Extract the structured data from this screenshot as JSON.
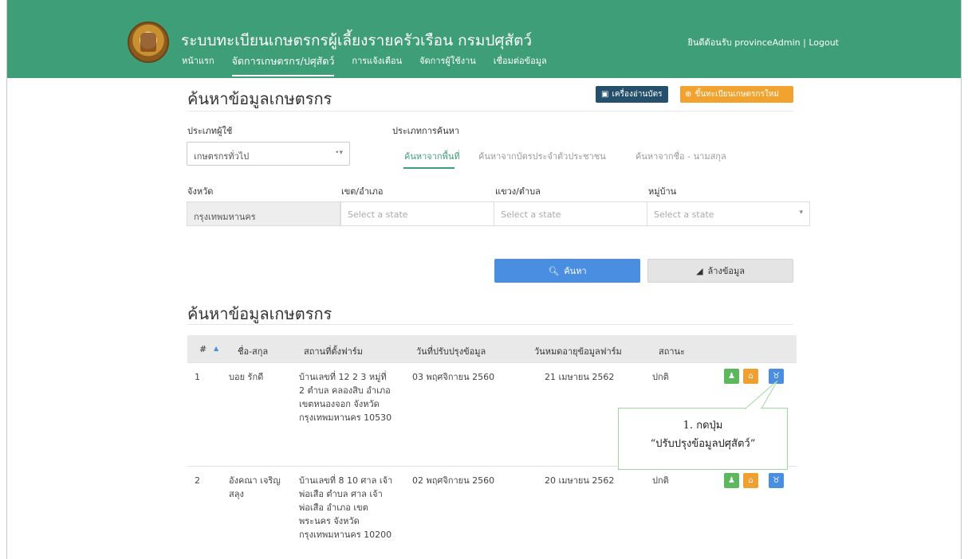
{
  "header": {
    "app_title": "ระบบทะเบียนเกษตรกรผู้เลี้ยงรายครัวเรือน กรมปศุสัตว์",
    "welcome": "ยินดีต้อนรับ provinceAdmin |",
    "logout": "Logout",
    "nav": [
      "หน้าแรก",
      "จัดการเกษตรกร/ปศุสัตว์",
      "การแจ้งเตือน",
      "จัดการผู้ใช้งาน",
      "เชื่อมต่อข้อมูล"
    ]
  },
  "search": {
    "title": "ค้นหาข้อมูลเกษตรกร",
    "reader_button": "เครื่องอ่านบัตร",
    "register_button": "ขึ้นทะเบียนเกษตรกรใหม่",
    "user_type_label": "ประเภทผู้ใช้",
    "user_type_value": "เกษตรกรทั่วไป",
    "search_type_label": "ประเภทการค้นหา",
    "tabs": [
      "ค้นหาจากพื้นที่",
      "ค้นหาจากบัตรประจำตัวประชาชน",
      "ค้นหาจากชื่อ - นามสกุล"
    ],
    "province_label": "จังหวัด",
    "district_label": "เขต/อำเภอ",
    "subdistrict_label": "แขวง/ตำบล",
    "village_label": "หมู่บ้าน",
    "province_value": "กรุงเทพมหานคร",
    "placeholder": "Select a state",
    "search_button": "ค้นหา",
    "clear_button": "ล้างข้อมูล"
  },
  "results": {
    "title": "ค้นหาข้อมูลเกษตรกร",
    "columns": [
      "#",
      "ชื่อ-สกุล",
      "สถานที่ตั้งฟาร์ม",
      "วันที่ปรับปรุงข้อมูล",
      "วันหมดอายุข้อมูลฟาร์ม",
      "สถานะ"
    ],
    "sort_indicator": "▲",
    "rows": [
      {
        "num": "1",
        "name": "บอย รักดี",
        "address": "บ้านเลขที่ 12 2 3 หมู่ที่ 2 ตำบล คลองสิบ อำเภอ เขตหนองจอก จังหวัด กรุงเทพมหานคร 10530",
        "updated": "03 พฤศจิกายน 2560",
        "expires": "21 เมษายน 2562",
        "status": "ปกติ"
      },
      {
        "num": "2",
        "name": "อังคณา เจริญสลุง",
        "address": "บ้านเลขที่ 8 10 ศาล เจ้าพ่อเสือ ตำบล ศาล เจ้าพ่อเสือ อำเภอ เขต พระนคร จังหวัด กรุงเทพมหานคร 10200",
        "updated": "02 พฤศจิกายน 2560",
        "expires": "20 เมษายน 2562",
        "status": "ปกติ"
      }
    ]
  },
  "callout": {
    "line1": "1. กดปุ่ม",
    "line2": "“ปรับปรุงข้อมูลปศุสัตว์”"
  },
  "colors": {
    "brand": "#3e9e78",
    "primary": "#4a8ee2",
    "warning": "#f0a030",
    "success": "#5cb85c",
    "reader": "#24506b"
  }
}
